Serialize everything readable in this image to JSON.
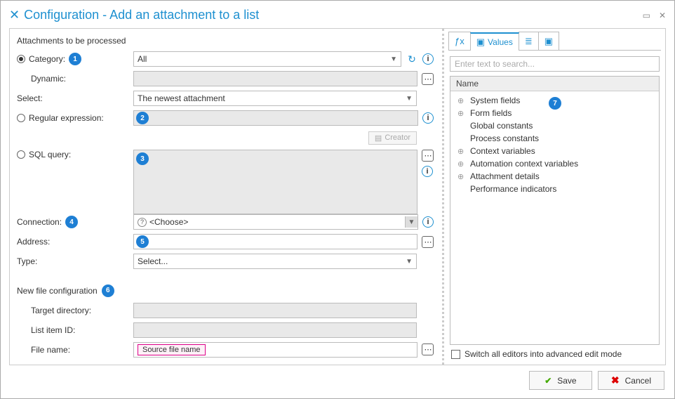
{
  "title": "Configuration - Add an attachment to a list",
  "section_attachments": "Attachments to be processed",
  "labels": {
    "category": "Category:",
    "dynamic": "Dynamic:",
    "select": "Select:",
    "regex": "Regular expression:",
    "sql": "SQL query:",
    "connection": "Connection:",
    "address": "Address:",
    "type": "Type:",
    "newfile": "New file configuration",
    "target_dir": "Target directory:",
    "list_item": "List item ID:",
    "file_name": "File name:"
  },
  "fields": {
    "category": "All",
    "dynamic": "",
    "select": "The newest attachment",
    "regex": "",
    "sql": "",
    "connection": "<Choose>",
    "address": "",
    "type": "Select...",
    "target_dir": "",
    "list_item": "",
    "file_name_token": "Source file name"
  },
  "creator_btn": "Creator",
  "markers": {
    "m1": "1",
    "m2": "2",
    "m3": "3",
    "m4": "4",
    "m5": "5",
    "m6": "6",
    "m7": "7"
  },
  "tabs": {
    "fx": "ƒx",
    "values": "Values"
  },
  "search_placeholder": "Enter text to search...",
  "tree_header": "Name",
  "tree": {
    "sys": "System fields",
    "form": "Form fields",
    "global": "Global constants",
    "process": "Process constants",
    "context": "Context variables",
    "autoctx": "Automation context variables",
    "attach": "Attachment details",
    "perf": "Performance indicators"
  },
  "advanced_mode": "Switch all editors into advanced edit mode",
  "buttons": {
    "save": "Save",
    "cancel": "Cancel"
  }
}
